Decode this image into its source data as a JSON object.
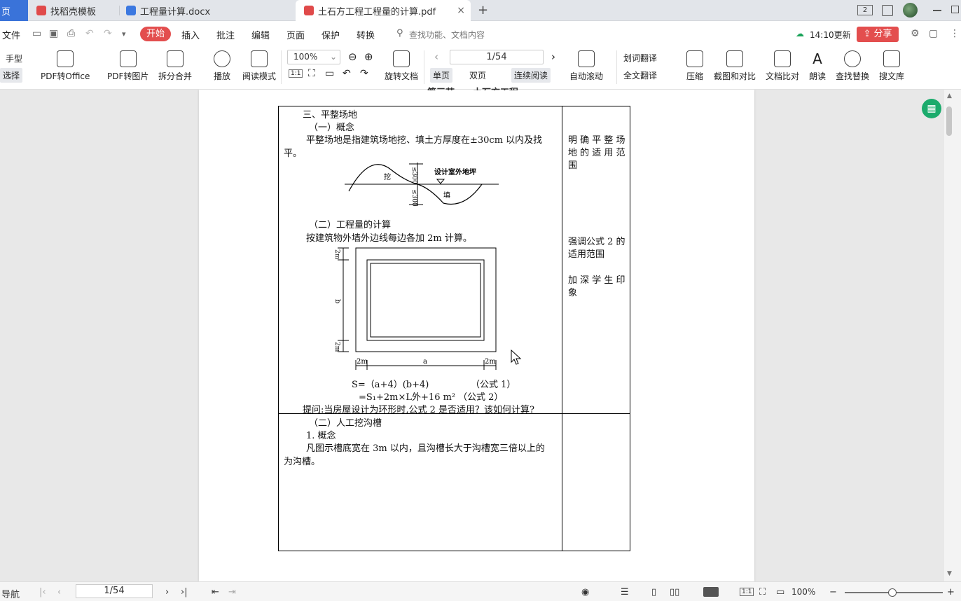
{
  "tabs": [
    {
      "label": "页"
    },
    {
      "label": "找稻壳模板"
    },
    {
      "label": "工程量计算.docx"
    },
    {
      "label": "土石方工程工程量的计算.pdf"
    }
  ],
  "tab_add": "+",
  "tab_close": "×",
  "badge": "2",
  "menu": {
    "file": "文件",
    "start": "开始",
    "items": [
      "插入",
      "批注",
      "编辑",
      "页面",
      "保护",
      "转换"
    ],
    "search_placeholder": "查找功能、文档内容",
    "update": "14:10更新",
    "share": "分享"
  },
  "toolbar": {
    "hand": "手型",
    "select": "选择",
    "pdf_to_office": "PDF转Office",
    "pdf_to_image": "PDF转图片",
    "split_merge": "拆分合并",
    "play": "播放",
    "read_mode": "阅读模式",
    "zoom": "100%",
    "rotate": "旋转文档",
    "page": "1/54",
    "single": "单页",
    "double": "双页",
    "continuous": "连续阅读",
    "auto_scroll": "自动滚动",
    "word_translate": "划词翻译",
    "full_translate": "全文翻译",
    "compress": "压缩",
    "screenshot_compare": "截图和对比",
    "doc_compare": "文档比对",
    "read_aloud": "朗读",
    "find_replace": "查找替换",
    "library": "搜文库",
    "fit_label": "1:1"
  },
  "document": {
    "heading": "三、平整场地",
    "sub1": "（一）概念",
    "p1a": "平整场地是指建筑场地挖、填土方厚度在±30cm 以内及找",
    "p1b": "平。",
    "fig1_labels": [
      "挖",
      "填",
      "设计室外地坪",
      "≤300",
      "≤300"
    ],
    "sub2": "（二）工程量的计算",
    "p2": "按建筑物外墙外边线每边各加 2m 计算。",
    "fig2_labels": [
      "2m",
      "a",
      "2m",
      "b",
      "2m",
      "2m"
    ],
    "formula1": "S=（a+4）(b+4)",
    "formula1_note": "（公式 1）",
    "formula2": "=S₁+2m×L外+16 m²",
    "formula2_note": "（公式 2）",
    "question": "提问:当房屋设计为环形时,公式 2 是否适用？该如何计算?",
    "sub3": "（二）人工挖沟槽",
    "sub3_1": "1. 概念",
    "p3a": "凡图示槽底宽在 3m 以内，且沟槽长大于沟槽宽三倍以上的",
    "p3b": "为沟槽。",
    "note1": [
      "明 确 平 整 场",
      "地 的 适 用 范",
      "围"
    ],
    "note2": [
      "强调公式 2 的",
      "适用范围"
    ],
    "note3": [
      "加 深 学 生 印",
      "象"
    ]
  },
  "status": {
    "nav": "导航",
    "page": "1/54",
    "zoom": "100%"
  }
}
